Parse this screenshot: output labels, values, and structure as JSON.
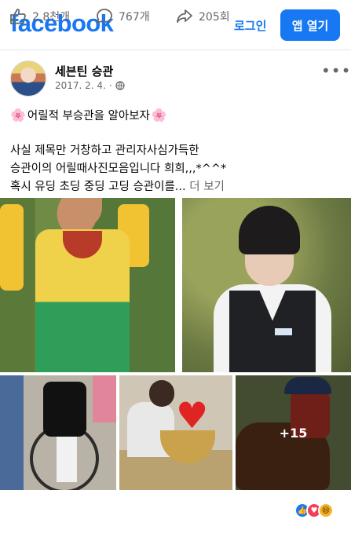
{
  "header": {
    "logo": "facebook",
    "login_label": "로그인",
    "open_app_label": "앱 열기"
  },
  "post": {
    "author": "세븐틴 승관",
    "date": "2017. 2. 4.",
    "title_line": "어릴적 부승관을 알아보자",
    "body_lines": [
      "사실 제목만 거창하고 관리자사심가득한",
      "승관이의 어릴때사진모음입니다 희희,,,*^^*",
      "혹시 유딩 초딩 중딩 고딩 승관이를..."
    ],
    "see_more_label": "더 보기",
    "more_photos_count": "+15"
  },
  "footer": {
    "likes": "2.8천개",
    "comments": "767개",
    "shares": "205회"
  },
  "colors": {
    "brand": "#1877f2",
    "text_secondary": "#65676b"
  }
}
